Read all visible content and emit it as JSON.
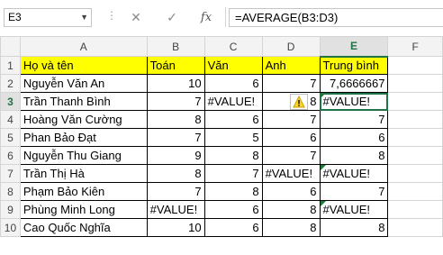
{
  "formula_bar": {
    "name_box": "E3",
    "cancel_icon": "✕",
    "enter_icon": "✓",
    "fx_label": "fx",
    "formula": "=AVERAGE(B3:D3)"
  },
  "columns": [
    "A",
    "B",
    "C",
    "D",
    "E",
    "F"
  ],
  "selected_column": "E",
  "selected_row": "3",
  "rows": [
    {
      "n": "1",
      "a": "Họ và tên",
      "b": "Toán",
      "c": "Văn",
      "d": "Anh",
      "e": "Trung bình"
    },
    {
      "n": "2",
      "a": "Nguyễn Văn An",
      "b": "10",
      "c": "6",
      "d": "7",
      "e": "7,6666667"
    },
    {
      "n": "3",
      "a": "Trần Thanh Bình",
      "b": "7",
      "c": "#VALUE!",
      "d": "8",
      "e": "#VALUE!"
    },
    {
      "n": "4",
      "a": "Hoàng Văn Cường",
      "b": "8",
      "c": "6",
      "d": "7",
      "e": "7"
    },
    {
      "n": "5",
      "a": "Phan Bảo Đạt",
      "b": "7",
      "c": "5",
      "d": "6",
      "e": "6"
    },
    {
      "n": "6",
      "a": "Nguyễn Thu Giang",
      "b": "9",
      "c": "8",
      "d": "7",
      "e": "8"
    },
    {
      "n": "7",
      "a": "Trần Thị Hà",
      "b": "8",
      "c": "7",
      "d": "#VALUE!",
      "e": "#VALUE!"
    },
    {
      "n": "8",
      "a": "Phạm Bảo Kiên",
      "b": "7",
      "c": "8",
      "d": "6",
      "e": "7"
    },
    {
      "n": "9",
      "a": "Phùng Minh Long",
      "b": "#VALUE!",
      "c": "6",
      "d": "8",
      "e": "#VALUE!"
    },
    {
      "n": "10",
      "a": "Cao Quốc Nghĩa",
      "b": "10",
      "c": "6",
      "d": "8",
      "e": "8"
    }
  ],
  "colors": {
    "accent": "#217346",
    "header_fill": "#ffff00",
    "error_flag": "#1d7a3c"
  },
  "icons": {
    "warning": "warning-icon"
  }
}
